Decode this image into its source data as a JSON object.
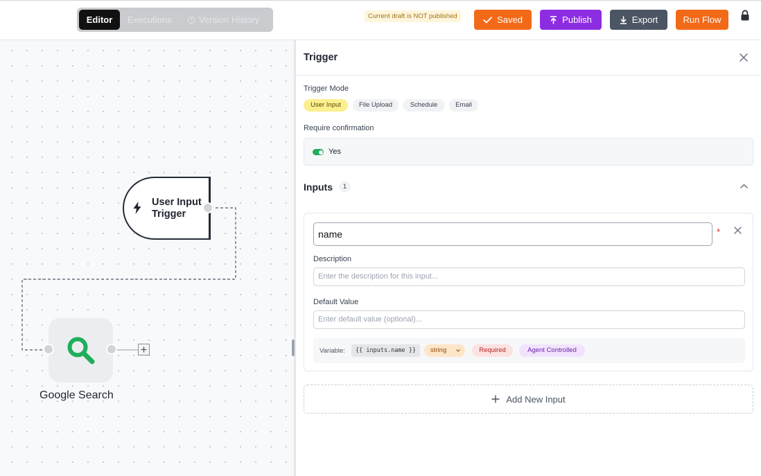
{
  "header": {
    "tabs": {
      "editor": "Editor",
      "executions": "Executions",
      "version_history": "Version History"
    },
    "draft_notice": "Current draft is NOT published",
    "buttons": {
      "saved": "Saved",
      "publish": "Publish",
      "export": "Export",
      "run_flow": "Run Flow"
    },
    "colors": {
      "orange": "#f26a18",
      "purple": "#8d2de2",
      "slate": "#4b5563"
    }
  },
  "canvas": {
    "trigger_node": {
      "title_line1": "User Input",
      "title_line2": "Trigger",
      "icon": "bolt-icon"
    },
    "search_node": {
      "label": "Google Search",
      "icon": "search-icon",
      "icon_color": "#1fae5b"
    }
  },
  "panel": {
    "title": "Trigger",
    "trigger_mode": {
      "label": "Trigger Mode",
      "options": [
        "User Input",
        "File Upload",
        "Schedule",
        "Email"
      ],
      "selected": "User Input"
    },
    "require_confirmation": {
      "label": "Require confirmation",
      "value": "Yes",
      "enabled": true
    },
    "inputs": {
      "title": "Inputs",
      "count": "1",
      "items": [
        {
          "name": "name",
          "required_marker": "*",
          "description_label": "Description",
          "description_placeholder": "Enter the description for this input...",
          "default_label": "Default Value",
          "default_placeholder": "Enter default value (optional)...",
          "variable_label": "Variable:",
          "variable_code": "{{ inputs.name }}",
          "type": "string",
          "required_badge": "Required",
          "agent_badge": "Agent Controlled"
        }
      ],
      "add_new_label": "Add New Input"
    }
  }
}
